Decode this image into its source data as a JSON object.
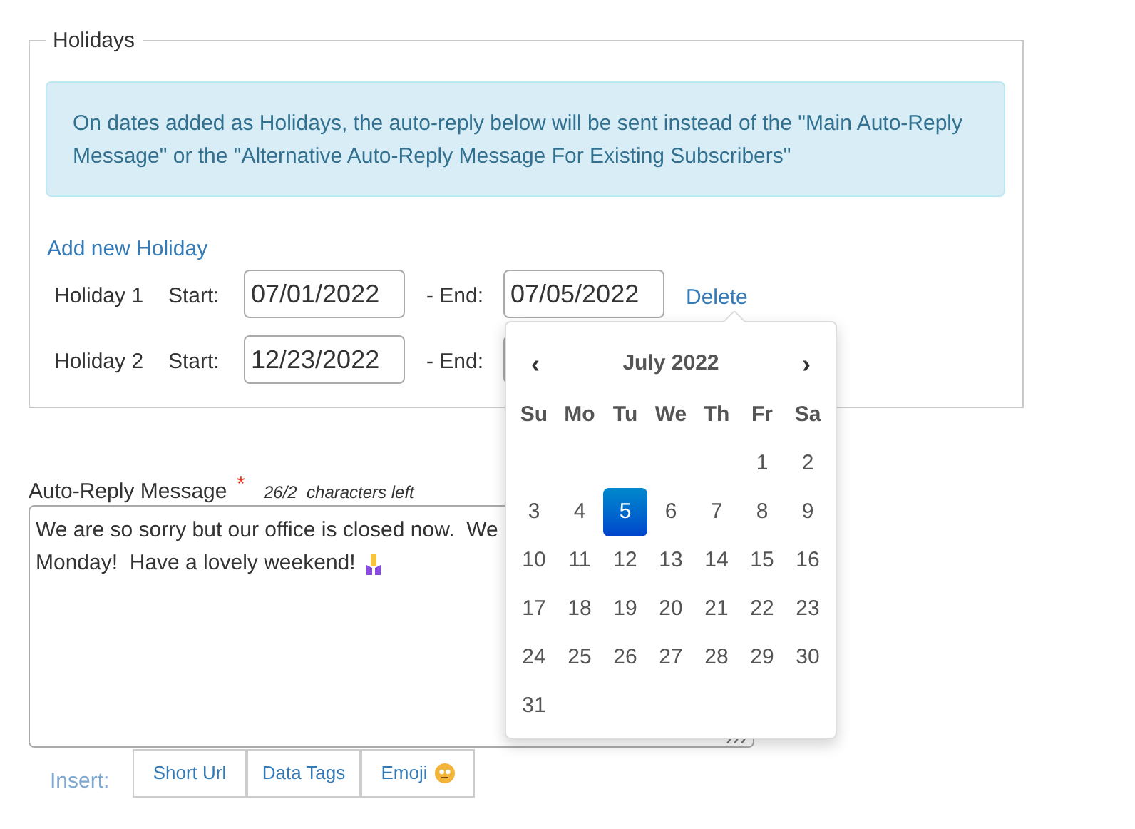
{
  "holidays_section": {
    "legend": "Holidays",
    "info": "On dates added as Holidays, the auto-reply below will be sent instead of the \"Main Auto-Reply Message\" or the \"Alternative Auto-Reply Message For Existing Subscribers\"",
    "add_link": "Add new Holiday",
    "holidays": [
      {
        "label": "Holiday 1",
        "start_label": "Start:",
        "start": "07/01/2022",
        "end_label": "- End:",
        "end": "07/05/2022",
        "delete": "Delete"
      },
      {
        "label": "Holiday 2",
        "start_label": "Start:",
        "start": "12/23/2022",
        "end_label": "- End:"
      }
    ]
  },
  "date_picker": {
    "prev": "‹",
    "title": "July 2022",
    "next": "›",
    "weekdays": [
      "Su",
      "Mo",
      "Tu",
      "We",
      "Th",
      "Fr",
      "Sa"
    ],
    "weeks": [
      [
        {
          "day": "1",
          "selected": false
        },
        {
          "day": "2",
          "selected": false
        }
      ],
      [
        {
          "day": "3",
          "selected": false
        },
        {
          "day": "4",
          "selected": false
        },
        {
          "day": "5",
          "selected": true
        },
        {
          "day": "6",
          "selected": false
        },
        {
          "day": "7",
          "selected": false
        },
        {
          "day": "8",
          "selected": false
        },
        {
          "day": "9",
          "selected": false
        }
      ],
      [
        {
          "day": "10",
          "selected": false
        },
        {
          "day": "11",
          "selected": false
        },
        {
          "day": "12",
          "selected": false
        },
        {
          "day": "13",
          "selected": false
        },
        {
          "day": "14",
          "selected": false
        },
        {
          "day": "15",
          "selected": false
        },
        {
          "day": "16",
          "selected": false
        }
      ],
      [
        {
          "day": "17",
          "selected": false
        },
        {
          "day": "18",
          "selected": false
        },
        {
          "day": "19",
          "selected": false
        },
        {
          "day": "20",
          "selected": false
        },
        {
          "day": "21",
          "selected": false
        },
        {
          "day": "22",
          "selected": false
        },
        {
          "day": "23",
          "selected": false
        }
      ],
      [
        {
          "day": "24",
          "selected": false
        },
        {
          "day": "25",
          "selected": false
        },
        {
          "day": "26",
          "selected": false
        },
        {
          "day": "27",
          "selected": false
        },
        {
          "day": "28",
          "selected": false
        },
        {
          "day": "29",
          "selected": false
        },
        {
          "day": "30",
          "selected": false
        }
      ],
      [
        {
          "day": "31",
          "selected": false
        }
      ]
    ]
  },
  "auto_reply": {
    "label": "Auto-Reply Message",
    "required_mark": "*",
    "counter": "26/2  characters left",
    "lines": [
      "We are so sorry but our office is closed now.  We",
      "Monday!  Have a lovely weekend!"
    ],
    "insert_label": "Insert:",
    "insert_buttons": [
      "Short Url",
      "Data Tags",
      "Emoji"
    ]
  }
}
